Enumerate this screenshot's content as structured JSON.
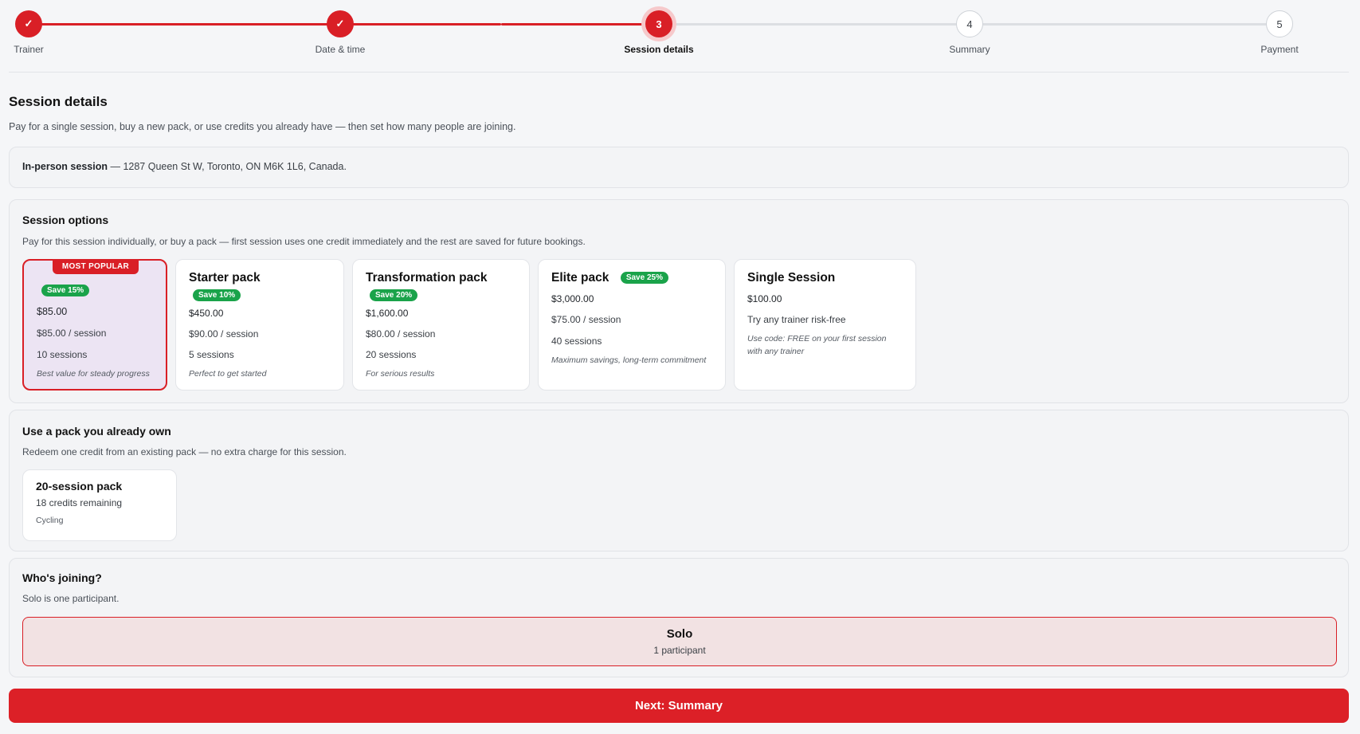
{
  "stepper": {
    "steps": [
      {
        "number": "1",
        "label": "Trainer",
        "state": "done"
      },
      {
        "number": "2",
        "label": "Date & time",
        "state": "done"
      },
      {
        "number": "3",
        "label": "Session details",
        "state": "current"
      },
      {
        "number": "4",
        "label": "Summary",
        "state": "todo"
      },
      {
        "number": "5",
        "label": "Payment",
        "state": "todo"
      }
    ],
    "check_glyph": "✓"
  },
  "header": {
    "title": "Session details",
    "subtitle": "Pay for a single session, buy a new pack, or use credits you already have — then set how many people are joining."
  },
  "location": {
    "type": "In-person session",
    "address": "— 1287 Queen St W, Toronto, ON M6K 1L6, Canada."
  },
  "session_options": {
    "title": "Session options",
    "subtitle": "Pay for this session individually, or buy a pack — first session uses one credit immediately and the rest are saved for future bookings.",
    "options": [
      {
        "name": "",
        "flag": "MOST POPULAR",
        "badge": "Save 15%",
        "price": "$85.00",
        "per_session": "$85.00 / session",
        "sessions": "10 sessions",
        "note": "Best value for steady progress",
        "selected": true
      },
      {
        "name": "Starter pack",
        "badge": "Save 10%",
        "price": "$450.00",
        "per_session": "$90.00 / session",
        "sessions": "5 sessions",
        "note": "Perfect to get started"
      },
      {
        "name": "Transformation pack",
        "badge": "Save 20%",
        "price": "$1,600.00",
        "per_session": "$80.00 / session",
        "sessions": "20 sessions",
        "note": "For serious results"
      },
      {
        "name": "Elite pack",
        "badge": "Save 25%",
        "price": "$3,000.00",
        "per_session": "$75.00 / session",
        "sessions": "40 sessions",
        "note": "Maximum savings, long-term commitment"
      },
      {
        "name": "Single Session",
        "price": "$100.00",
        "tagline": "Try any trainer risk-free",
        "note": "Use code: FREE on your first session with any trainer"
      }
    ]
  },
  "own_pack": {
    "title": "Use a pack you already own",
    "subtitle": "Redeem one credit from an existing pack — no extra charge for this session.",
    "pack": {
      "name": "20-session pack",
      "credits": "18 credits remaining",
      "category": "Cycling"
    }
  },
  "joining": {
    "title": "Who's joining?",
    "subtitle": "Solo is one participant.",
    "option": {
      "name": "Solo",
      "sub": "1 participant"
    }
  },
  "next_button": {
    "label": "Next: Summary"
  },
  "colors": {
    "accent": "#d91f26",
    "badge_green": "#1aa34a",
    "selected_bg": "#ece4f3"
  }
}
